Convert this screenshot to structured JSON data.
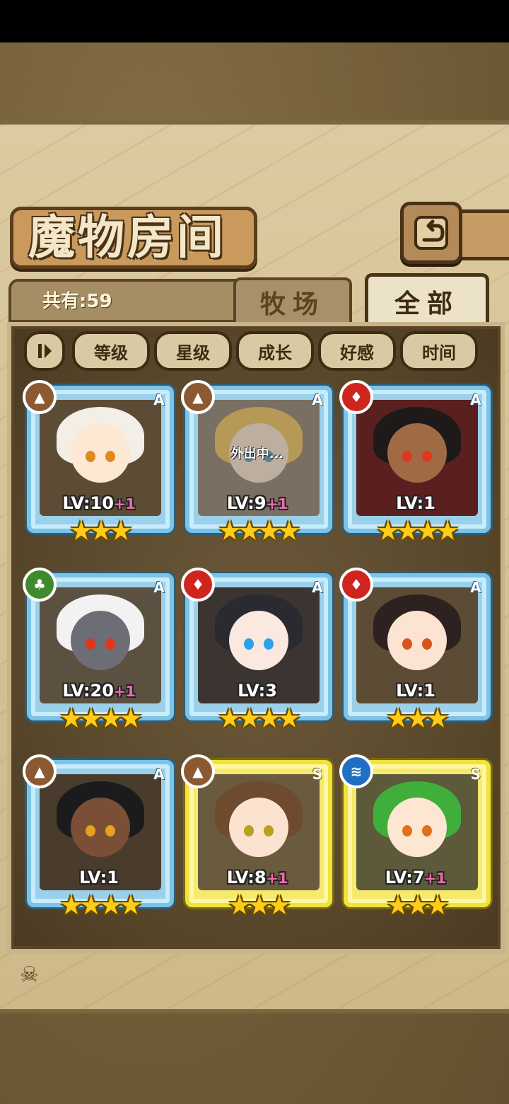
{
  "screen_title": "魔物房间",
  "count_text": "共有:59",
  "tabs": {
    "ranch": "牧场",
    "all": "全部"
  },
  "sort_buttons": [
    "等级",
    "星级",
    "成长",
    "好感",
    "时间"
  ],
  "icons": {
    "back": "back-arrow-icon",
    "toggle": "sort-order-icon"
  },
  "monsters": [
    {
      "element": "earth",
      "rank": "A",
      "level": "LV:10",
      "bonus": "+1",
      "stars": "★★★",
      "status": "",
      "colors": {
        "bg": "#5c4b35",
        "hair": "#f4efe6",
        "skin": "#fde8d4",
        "eye": "#e08a1e"
      }
    },
    {
      "element": "earth",
      "rank": "A",
      "level": "LV:9",
      "bonus": "+1",
      "stars": "★★★★",
      "status": "外出中...",
      "colors": {
        "bg": "#7a6850",
        "hair": "#e9b33c",
        "skin": "#f6dcc0",
        "eye": "#3b8e9c"
      }
    },
    {
      "element": "fire",
      "rank": "A",
      "level": "LV:1",
      "bonus": "",
      "stars": "★★★★",
      "status": "",
      "colors": {
        "bg": "#5a2020",
        "hair": "#1e1a1a",
        "skin": "#a06a45",
        "eye": "#e0361c"
      }
    },
    {
      "element": "grass",
      "rank": "A",
      "level": "LV:20",
      "bonus": "+1",
      "stars": "★★★★",
      "status": "",
      "colors": {
        "bg": "#5c5040",
        "hair": "#f2f2f2",
        "skin": "#6d6d75",
        "eye": "#e0361c"
      }
    },
    {
      "element": "fire",
      "rank": "A",
      "level": "LV:3",
      "bonus": "",
      "stars": "★★★★",
      "status": "",
      "colors": {
        "bg": "#3c3430",
        "hair": "#2a2a30",
        "skin": "#fbe8df",
        "eye": "#2ba3e8"
      }
    },
    {
      "element": "fire",
      "rank": "A",
      "level": "LV:1",
      "bonus": "",
      "stars": "★★★",
      "status": "",
      "colors": {
        "bg": "#5c4b35",
        "hair": "#2e2220",
        "skin": "#fde3d2",
        "eye": "#d8541e"
      }
    },
    {
      "element": "earth",
      "rank": "A",
      "level": "LV:1",
      "bonus": "",
      "stars": "★★★★",
      "status": "",
      "colors": {
        "bg": "#4a3c2c",
        "hair": "#1b1b1e",
        "skin": "#7a4f35",
        "eye": "#e8a01e"
      }
    },
    {
      "element": "earth",
      "rank": "S",
      "level": "LV:8",
      "bonus": "+1",
      "stars": "★★★",
      "status": "",
      "colors": {
        "bg": "#6a5a3e",
        "hair": "#6e4a2e",
        "skin": "#fbe3d0",
        "eye": "#b8a020"
      },
      "gold": true
    },
    {
      "element": "water",
      "rank": "S",
      "level": "LV:7",
      "bonus": "+1",
      "stars": "★★★",
      "status": "",
      "colors": {
        "bg": "#5c5a3a",
        "hair": "#3fae3a",
        "skin": "#fde6d2",
        "eye": "#e0701e"
      },
      "gold": true
    }
  ]
}
